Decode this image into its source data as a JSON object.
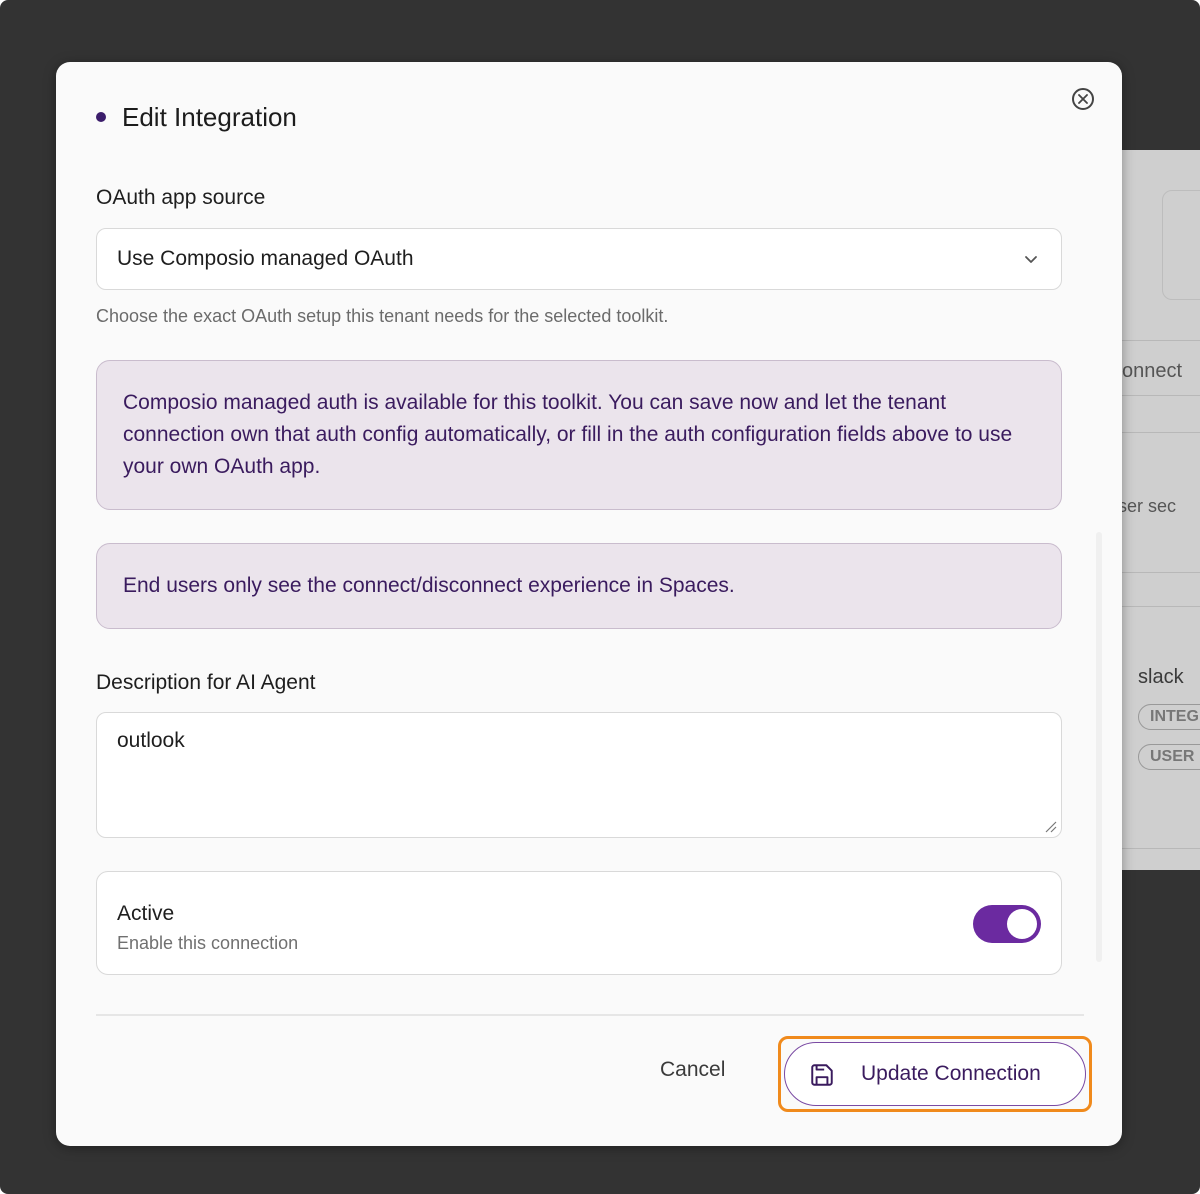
{
  "background": {
    "partial_texts": [
      "onnect",
      "user sec",
      "slack"
    ],
    "pills": [
      "INTEG",
      "USER"
    ]
  },
  "modal": {
    "title": "Edit Integration",
    "oauth": {
      "label": "OAuth app source",
      "selected": "Use Composio managed OAuth",
      "hint": "Choose the exact OAuth setup this tenant needs for the selected toolkit."
    },
    "notice_managed": "Composio managed auth is available for this toolkit. You can save now and let the tenant connection own that auth config automatically, or fill in the auth configuration fields above to use your own OAuth app.",
    "notice_spaces": "End users only see the connect/disconnect experience in Spaces.",
    "description": {
      "label": "Description for AI Agent",
      "value": "outlook"
    },
    "active": {
      "title": "Active",
      "subtitle": "Enable this connection",
      "enabled": true
    },
    "footer": {
      "cancel_label": "Cancel",
      "update_label": "Update Connection"
    }
  },
  "colors": {
    "accent": "#6b2aa0",
    "notice_bg": "#ebe4ec",
    "focus_ring": "#f08a1c"
  },
  "icons": [
    "close-circle-icon",
    "chevron-down-icon",
    "save-icon"
  ]
}
